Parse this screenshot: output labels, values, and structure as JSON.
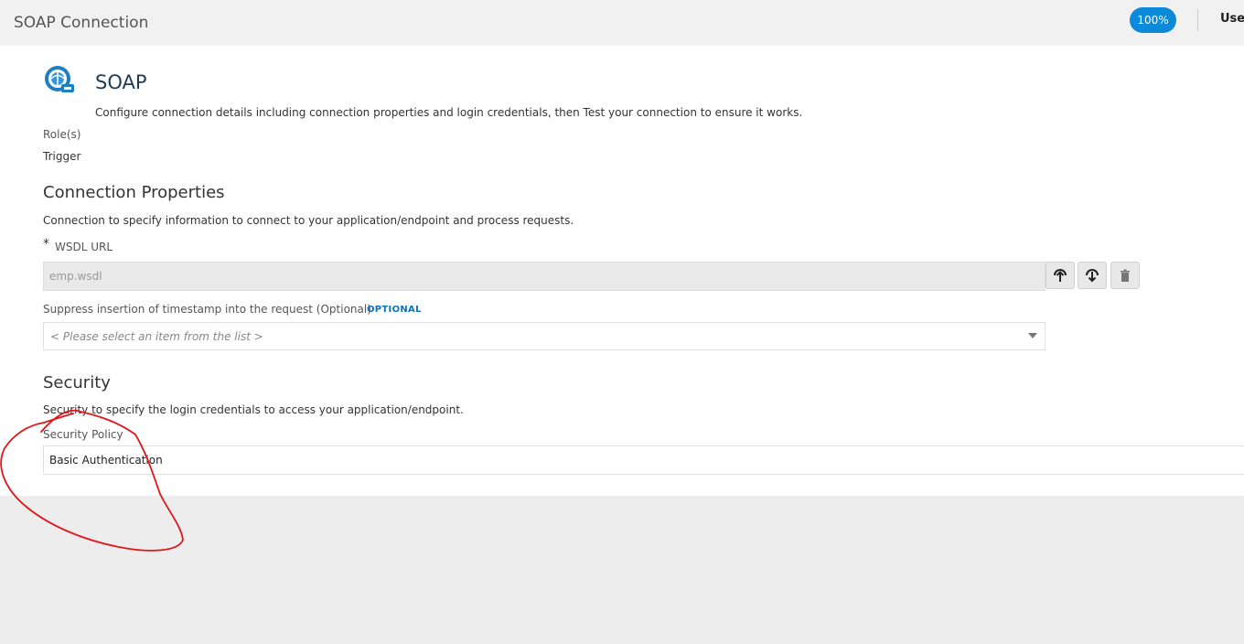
{
  "header": {
    "title": "SOAP Connection",
    "progress_badge": "100%",
    "used_label": "Used"
  },
  "adapter": {
    "name": "SOAP",
    "description": "Configure connection details including connection properties and login credentials, then Test your connection to ensure it works."
  },
  "roles": {
    "label": "Role(s)",
    "value": "Trigger"
  },
  "connection_properties": {
    "heading": "Connection Properties",
    "description": "Connection to specify information to connect to your application/endpoint and process requests.",
    "wsdl": {
      "required_mark": "*",
      "label": "WSDL URL",
      "value": "emp.wsdl"
    },
    "wsdl_buttons": [
      "upload-icon",
      "download-icon",
      "trash-icon"
    ],
    "timestamp": {
      "label": "Suppress insertion of timestamp into the request (Optional)",
      "optional_tag": "OPTIONAL",
      "placeholder": "< Please select an item from the list >"
    }
  },
  "security": {
    "heading": "Security",
    "description": "Security to specify the login credentials to access your application/endpoint.",
    "policy_label": "Security Policy",
    "policy_value": "Basic Authentication"
  },
  "colors": {
    "accent": "#0a8ad8",
    "optional_tag": "#0a72b7",
    "annotation": "#e0161b"
  }
}
